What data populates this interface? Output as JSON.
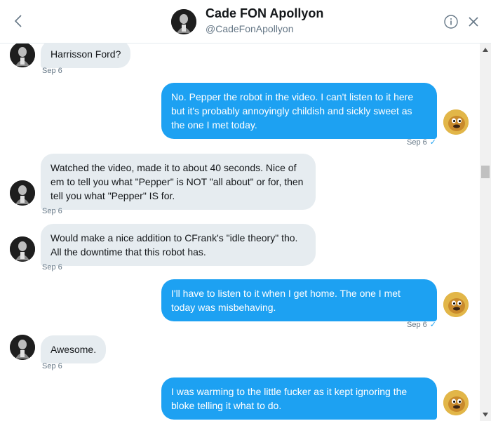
{
  "header": {
    "name": "Cade FON Apollyon",
    "handle": "@CadeFonApollyon",
    "back_icon": "chevron-left-icon",
    "info_icon": "info-icon",
    "close_icon": "close-icon"
  },
  "colors": {
    "outgoing_bubble": "#1da1f2",
    "incoming_bubble": "#e6ecf0",
    "timestamp": "#657786"
  },
  "messages": [
    {
      "direction": "in",
      "text": "Harrisson Ford?",
      "time": "Sep 6"
    },
    {
      "direction": "out",
      "text": "No. Pepper the robot in the video. I can't listen to it here but it's probably annoyingly childish and sickly sweet as the one I met today.",
      "time": "Sep 6",
      "status": "✓"
    },
    {
      "direction": "in",
      "text": "Watched the video, made it to about 40 seconds. Nice of em to tell you what \"Pepper\" is NOT \"all about\" or for, then tell you what \"Pepper\" IS for.",
      "time": "Sep 6"
    },
    {
      "direction": "in",
      "text": "Would make a nice addition to CFrank's \"idle theory\" tho. All the downtime that this robot has.",
      "time": "Sep 6"
    },
    {
      "direction": "out",
      "text": "I'll have to listen to it when I get home. The one I met today was misbehaving.",
      "time": "Sep 6",
      "status": "✓"
    },
    {
      "direction": "in",
      "text": "Awesome.",
      "time": "Sep 6"
    },
    {
      "direction": "out",
      "text": "I was warming to the little fucker as it kept ignoring the bloke telling it what to do.",
      "time": "",
      "status": ""
    }
  ]
}
